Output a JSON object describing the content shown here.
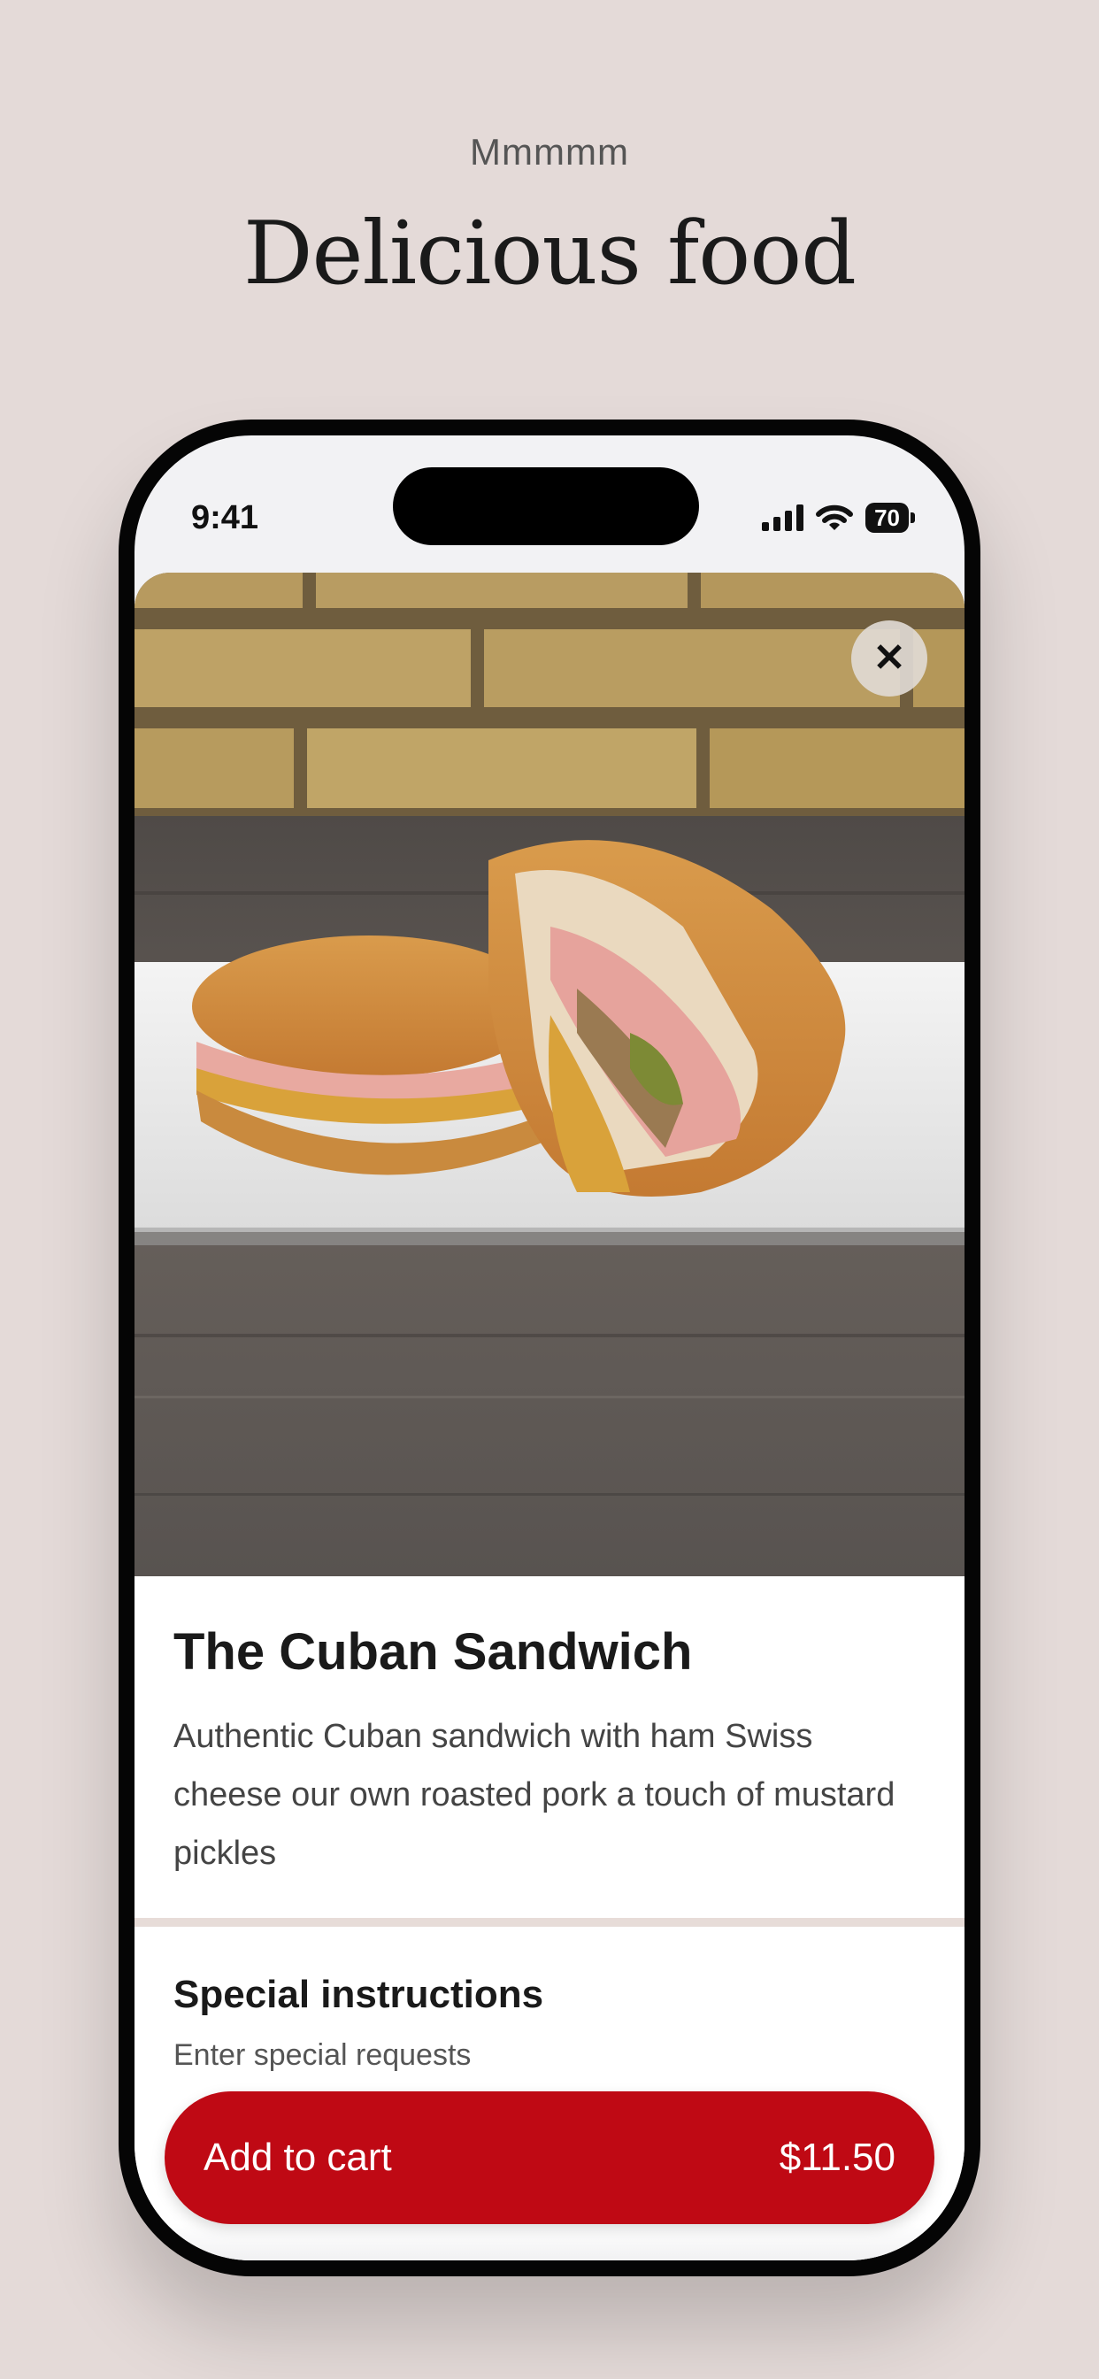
{
  "header": {
    "eyebrow": "Mmmmm",
    "headline": "Delicious food"
  },
  "status_bar": {
    "time": "9:41",
    "battery": "70",
    "icons": [
      "signal-icon",
      "wifi-icon",
      "battery-icon"
    ]
  },
  "item": {
    "image_alt": "The Cuban Sandwich",
    "title": "The Cuban Sandwich",
    "description": "Authentic Cuban sandwich with ham Swiss cheese our own roasted pork a touch of mustard pickles"
  },
  "special_instructions": {
    "title": "Special instructions",
    "placeholder": "Enter special requests"
  },
  "cart": {
    "label": "Add to cart",
    "price": "$11.50"
  },
  "colors": {
    "page_background": "#e4dad8",
    "accent": "#bf0914",
    "divider": "#e7dcd8"
  }
}
